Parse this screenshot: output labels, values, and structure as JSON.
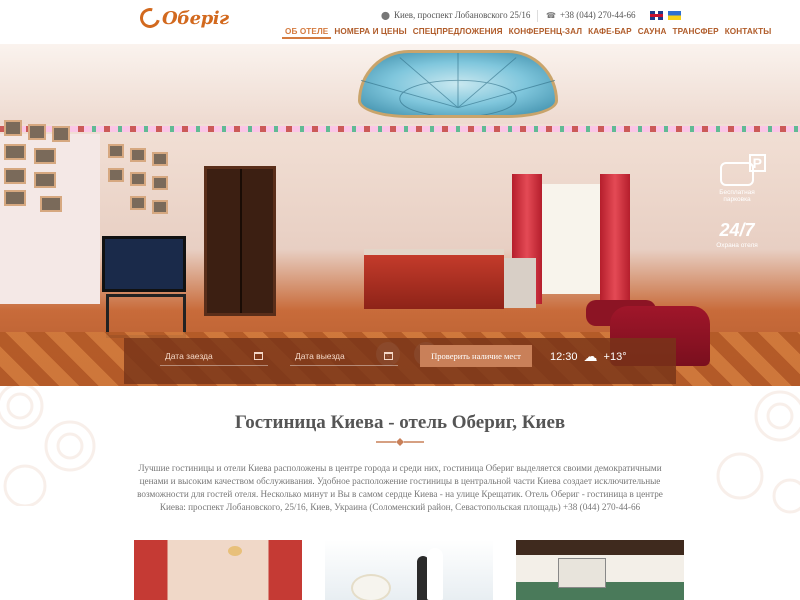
{
  "header": {
    "logo_text": "Оберіг",
    "address": "Киев, проспект Лобановского 25/16",
    "phone": "+38 (044) 270-44-66",
    "languages": [
      "English",
      "Українська"
    ]
  },
  "nav": {
    "items": [
      {
        "label": "ОБ ОТЕЛЕ",
        "active": true
      },
      {
        "label": "НОМЕРА И ЦЕНЫ",
        "active": false
      },
      {
        "label": "СПЕЦПРЕДЛОЖЕНИЯ",
        "active": false
      },
      {
        "label": "КОНФЕРЕНЦ-ЗАЛ",
        "active": false
      },
      {
        "label": "КАФЕ-БАР",
        "active": false
      },
      {
        "label": "САУНА",
        "active": false
      },
      {
        "label": "ТРАНСФЕР",
        "active": false
      },
      {
        "label": "КОНТАКТЫ",
        "active": false
      }
    ]
  },
  "hero": {
    "badges": [
      {
        "icon": "parking-icon",
        "label": "Бесплатная парковка"
      },
      {
        "icon": "camera-icon",
        "label": "Охрана отеля",
        "text": "24/7"
      }
    ]
  },
  "booking": {
    "checkin_placeholder": "Дата заезда",
    "checkout_placeholder": "Дата выезда",
    "check_button": "Проверить наличие мест",
    "time": "12:30",
    "temperature": "+13°"
  },
  "content": {
    "title": "Гостиница Киева - отель Обериг, Киев",
    "paragraph": "Лучшие гостиницы и отели Киева расположены в центре города и среди них, гостиница Обериг выделяется своими демократичными ценами и высоким качеством обслуживания. Удобное расположение гостиницы в центральной части Киева создает исключительные возможности для гостей отеля. Несколько минут и Вы в самом сердце Киева - на улице Крещатик. Отель Обериг - гостиница в центре Киева: проспект Лобановского, 25/16, Киев, Украина (Соломенский район, Севастопольская площадь) +38 (044) 270-44-66"
  },
  "colors": {
    "accent": "#b05c2a",
    "booking_bar": "#78341a",
    "button": "#c98059"
  }
}
